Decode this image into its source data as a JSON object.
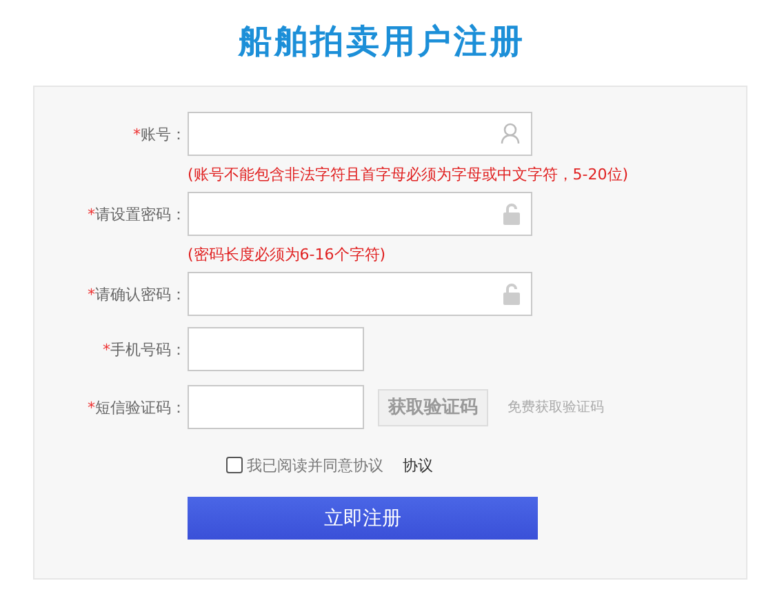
{
  "title": "船舶拍卖用户注册",
  "fields": [
    {
      "kind": "user",
      "mark": "*",
      "label": "账号：",
      "hint": "(账号不能包含非法字符且首字母必须为字母或中文字符，5-20位)"
    },
    {
      "kind": "lock",
      "mark": "*",
      "label": "请设置密码：",
      "hint": "(密码长度必须为6-16个字符)"
    },
    {
      "kind": "lock",
      "mark": "*",
      "label": "请确认密码："
    },
    {
      "kind": "short",
      "mark": "*",
      "label": "手机号码："
    },
    {
      "kind": "code",
      "mark": "*",
      "label": "短信验证码：",
      "button": "获取验证码",
      "note": "免费获取验证码"
    }
  ],
  "agreement": {
    "checked": false,
    "label": "我已阅读并同意协议",
    "link": "协议"
  },
  "submit": "立即注册"
}
